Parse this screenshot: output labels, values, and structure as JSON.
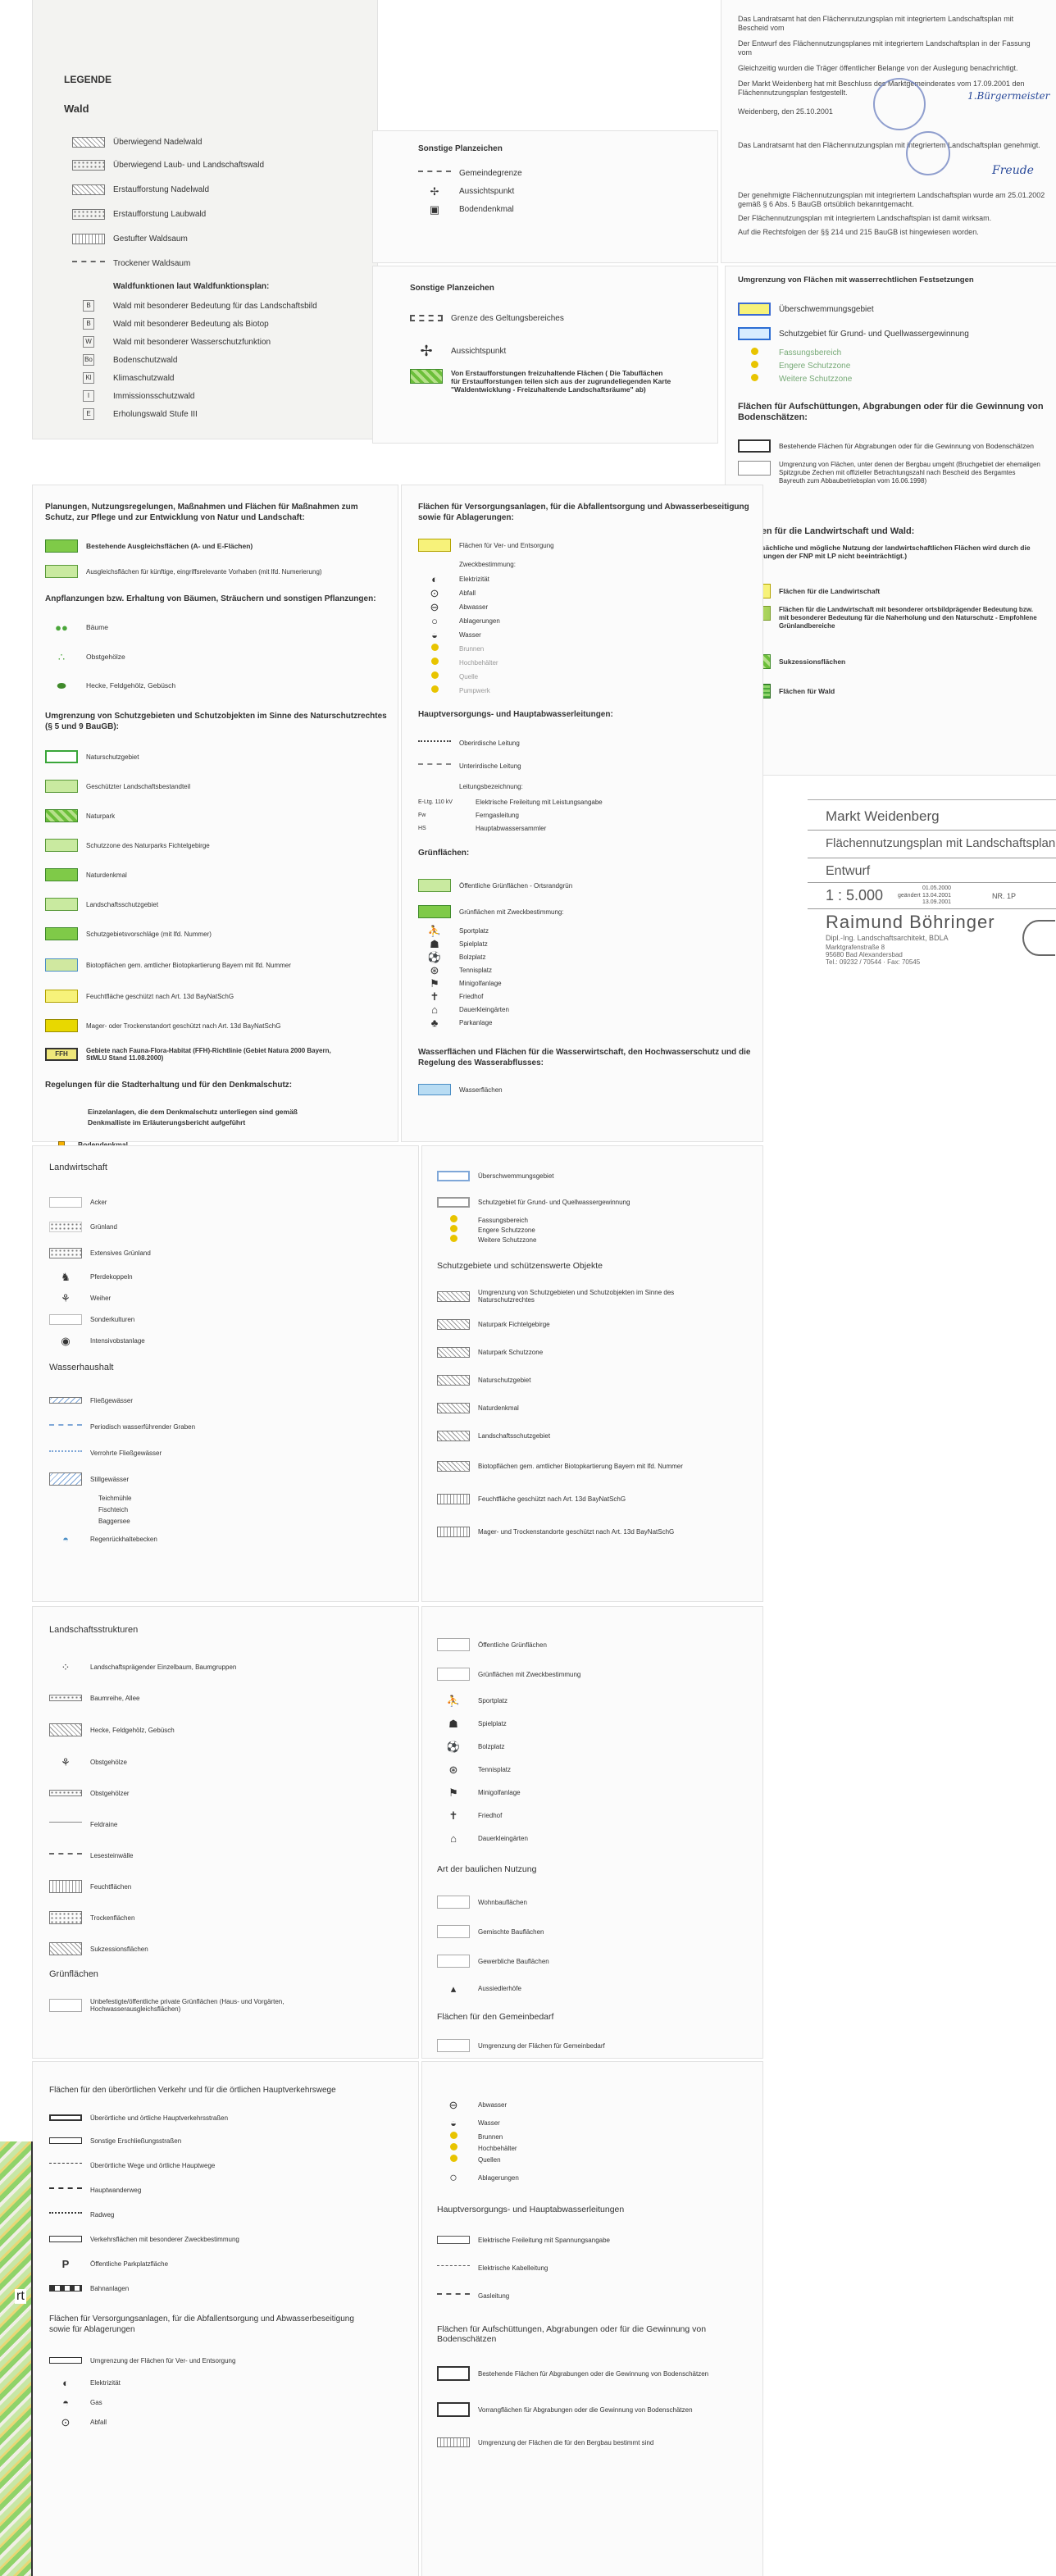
{
  "sheet1": {
    "title": "LEGENDE",
    "wald_heading": "Wald",
    "items": [
      "Überwiegend Nadelwald",
      "Überwiegend Laub- und Landschaftswald",
      "Erstaufforstung Nadelwald",
      "Erstaufforstung Laubwald",
      "Gestufter Waldsaum",
      "Trockener Waldsaum",
      "Waldfunktionen laut Waldfunktionsplan:",
      "Wald mit besonderer Bedeutung für das Landschaftsbild",
      "Wald mit besonderer Bedeutung als Biotop",
      "Wald mit besonderer Wasserschutzfunktion",
      "Bodenschutzwald",
      "Klimaschutzwald",
      "Immissionsschutzwald",
      "Erholungswald Stufe III"
    ],
    "symbols": [
      "L",
      "L",
      "L",
      "L",
      "L",
      "L",
      "",
      "B",
      "B",
      "W",
      "Bo",
      "Kl",
      "I",
      "E"
    ]
  },
  "sheet2": {
    "title": "Sonstige Planzeichen",
    "items": [
      "Gemeindegrenze",
      "Aussichtspunkt",
      "Bodendenkmal"
    ]
  },
  "sheet3": {
    "lines": [
      "Das Landratsamt hat den Flächennutzungsplan mit integriertem Landschaftsplan mit Bescheid vom",
      "Der Entwurf des Flächennutzungsplanes mit integriertem Landschaftsplan in der Fassung vom",
      "Gleichzeitig wurden die Träger öffentlicher Belange von der Auslegung benachrichtigt.",
      "Der Markt Weidenberg hat mit Beschluss des Marktgemeinderates vom 17.09.2001 den Flächennutzungsplan festgestellt.",
      "Weidenberg, den 25.10.2001",
      "Das Landratsamt hat den Flächennutzungsplan mit integriertem Landschaftsplan genehmigt.",
      "Der genehmigte Flächennutzungsplan mit integriertem Landschaftsplan wurde am 25.01.2002 gemäß § 6 Abs. 5 BauGB ortsüblich bekanntgemacht.",
      "Der Flächennutzungsplan mit integriertem Landschaftsplan ist damit wirksam.",
      "Auf die Rechtsfolgen der §§ 214 und 215 BauGB ist hingewiesen worden."
    ],
    "signatures": [
      "1.Bürgermeister",
      "Freude"
    ]
  },
  "sheet4": {
    "title": "Sonstige Planzeichen",
    "items": [
      "Grenze des Geltungsbereiches",
      "Aussichtspunkt",
      "Von Erstaufforstungen freizuhaltende Flächen ( Die Tabuflächen für Erstaufforstungen teilen sich aus der zugrundeliegenden Karte \"Waldentwicklung - Freizuhaltende Landschaftsräume\" ab)"
    ]
  },
  "sheet5": {
    "h1": "Umgrenzung von Flächen mit wasserrechtlichen Festsetzungen",
    "i1": [
      "Überschwemmungsgebiet",
      "Schutzgebiet für Grund- und Quellwassergewinnung",
      "Fassungsbereich",
      "Engere Schutzzone",
      "Weitere Schutzzone"
    ],
    "h2": "Flächen für Aufschüttungen, Abgrabungen oder für die Gewinnung von Bodenschätzen:",
    "i2": [
      "Bestehende Flächen für Abgrabungen oder für die Gewinnung von Bodenschätzen",
      "Umgrenzung von Flächen, unter denen der Bergbau umgeht (Bruchgebiet der ehemaligen Spitzgrube Zechen mit offizieller Betrachtungszahl nach Bescheid des Bergamtes Bayreuth zum Abbaubetriebsplan vom 16.06.1998)"
    ],
    "h3": "Flächen für die Landwirtschaft und Wald:",
    "sub3": "(Die tatsächliche und mögliche Nutzung der landwirtschaftlichen Flächen wird durch die Darstellungen der FNP mit LP nicht beeinträchtigt.)",
    "i3": [
      "Flächen für die Landwirtschaft",
      "Flächen für die Landwirtschaft mit besonderer ortsbildprägender Bedeutung bzw. mit besonderer Bedeutung für die Naherholung und den Naturschutz - Empfohlene Grünlandbereiche",
      "Sukzessionsflächen",
      "Flächen für Wald"
    ]
  },
  "titleblock": {
    "place": "Markt Weidenberg",
    "plan": "Flächennutzungsplan mit Landschaftsplan",
    "stage": "Entwurf",
    "scale": "1 : 5.000",
    "date1": "01.05.2000",
    "date2": "13.04.2001",
    "date3": "13.09.2001",
    "changed": "geändert",
    "ref": "NR. 1P",
    "firm": "Raimund Böhringer",
    "firm_sub": "Dipl.-Ing. Landschaftsarchitekt, BDLA",
    "street": "Marktgrafenstraße 8",
    "city": "95680 Bad Alexandersbad",
    "tel": "Tel.: 09232 / 70544 · Fax: 70545"
  },
  "sheet6": {
    "h1": "Planungen, Nutzungsregelungen, Maßnahmen und Flächen für Maßnahmen zum Schutz, zur Pflege und zur Entwicklung von Natur und Landschaft:",
    "i1": [
      "Bestehende Ausgleichsflächen (A- und E-Flächen)",
      "Ausgleichsflächen für künftige, eingriffsrelevante Vorhaben (mit lfd. Numerierung)"
    ],
    "h2": "Anpflanzungen bzw. Erhaltung von Bäumen, Sträuchern und sonstigen Pflanzungen:",
    "i2": [
      "Bäume",
      "Obstgehölze",
      "Hecke, Feldgehölz, Gebüsch"
    ],
    "h3": "Umgrenzung von Schutzgebieten und Schutzobjekten im Sinne des Naturschutzrechtes (§ 5 und 9 BauGB):",
    "i3": [
      "Naturschutzgebiet",
      "Geschützter Landschaftsbestandteil",
      "Naturpark",
      "Schutzzone des Naturparks Fichtelgebirge",
      "Naturdenkmal",
      "Landschaftsschutzgebiet",
      "Schutzgebietsvorschläge (mit lfd. Nummer)",
      "Biotopflächen gem. amtlicher Biotopkartierung Bayern mit lfd. Nummer",
      "Feuchtfläche geschützt nach Art. 13d BayNatSchG",
      "Mager- oder Trockenstandort geschützt nach Art. 13d BayNatSchG",
      "Gebiete nach Fauna-Flora-Habitat (FFH)-Richtlinie (Gebiet Natura 2000 Bayern, StMLU Stand 11.08.2000)"
    ],
    "h4": "Regelungen für die Stadterhaltung und für den Denkmalschutz:",
    "i4text": "Einzelanlagen, die dem Denkmalschutz unterliegen sind gemäß Denkmalliste im Erläuterungsbericht aufgeführt",
    "i4": "Bodendenkmal"
  },
  "sheet7": {
    "h1": "Flächen für Versorgungsanlagen, für die Abfallentsorgung und Abwasserbeseitigung sowie für Ablagerungen:",
    "i1": [
      "Flächen für Ver- und Entsorgung",
      "Zweckbestimmung:",
      "Elektrizität",
      "Abfall",
      "Abwasser",
      "Ablagerungen",
      "Wasser",
      "Brunnen",
      "Hochbehälter",
      "Quelle",
      "Pumpwerk"
    ],
    "h2": "Hauptversorgungs- und Hauptabwasserleitungen:",
    "i2": [
      "Oberirdische Leitung",
      "Unterirdische Leitung",
      "Leitungsbezeichnung:"
    ],
    "codes": [
      [
        "E-Ltg. 110 kV",
        "Elektrische Freileitung mit Leistungsangabe"
      ],
      [
        "Fw",
        "Ferngasleitung"
      ],
      [
        "HS",
        "Hauptabwassersammler"
      ]
    ],
    "h3": "Grünflächen:",
    "i3": [
      "Öffentliche Grünflächen - Ortsrandgrün",
      "Grünflächen mit Zweckbestimmung:",
      "Sportplatz",
      "Spielplatz",
      "Bolzplatz",
      "Tennisplatz",
      "Minigolfanlage",
      "Friedhof",
      "Dauerkleingärten",
      "Parkanlage"
    ],
    "h4": "Wasserflächen und Flächen für die Wasserwirtschaft, den Hochwasserschutz und die Regelung des Wasserabflusses:",
    "i4": [
      "Wasserflächen"
    ]
  },
  "sheet8": {
    "h1": "Landwirtschaft",
    "i1": [
      "Acker",
      "Grünland",
      "Extensives Grünland",
      "Pferdekoppeln",
      "Weiher",
      "Sonderkulturen",
      "Intensivobstanlage"
    ],
    "h2": "Wasserhaushalt",
    "i2": [
      "Fließgewässer",
      "Periodisch wasserführender Graben",
      "Verrohrte Fließgewässer",
      "Stillgewässer",
      "Teichmühle",
      "Fischteich",
      "Baggersee",
      "Regenrückhaltebecken"
    ]
  },
  "sheet9": {
    "i1": [
      "Überschwemmungsgebiet",
      "Schutzgebiet für Grund- und Quellwassergewinnung",
      "Fassungsbereich",
      "Engere Schutzzone",
      "Weitere Schutzzone"
    ],
    "h2": "Schutzgebiete und schützenswerte Objekte",
    "i2": [
      "Umgrenzung von Schutzgebieten und Schutzobjekten im Sinne des Naturschutzrechtes",
      "Naturpark Fichtelgebirge",
      "Naturpark Schutzzone",
      "Naturschutzgebiet",
      "Naturdenkmal",
      "Landschaftsschutzgebiet",
      "Biotopflächen gem. amtlicher Biotopkartierung Bayern mit lfd. Nummer",
      "Feuchtfläche geschützt nach Art. 13d BayNatSchG",
      "Mager- und Trockenstandorte geschützt nach Art. 13d BayNatSchG"
    ]
  },
  "sheet10": {
    "h1": "Landschaftsstrukturen",
    "i1": [
      "Landschaftsprägender Einzelbaum, Baumgruppen",
      "Baumreihe, Allee",
      "Hecke, Feldgehölz, Gebüsch",
      "Obstgehölze",
      "Obstgehölzer",
      "Feldraine",
      "Lesesteinwälle",
      "Feuchtflächen",
      "Trockenflächen",
      "Sukzessionsflächen"
    ],
    "h2": "Grünflächen",
    "i2": [
      "Unbefestigte/öffentliche private Grünflächen (Haus- und Vorgärten, Hochwasserausgleichsflächen)"
    ]
  },
  "sheet11": {
    "i1": [
      "Öffentliche Grünflächen",
      "Grünflächen mit Zweckbestimmung",
      "Sportplatz",
      "Spielplatz",
      "Bolzplatz",
      "Tennisplatz",
      "Minigolfanlage",
      "Friedhof",
      "Dauerkleingärten"
    ],
    "h2": "Art der baulichen Nutzung",
    "i2": [
      "Wohnbauflächen",
      "Gemischte Bauflächen",
      "Gewerbliche Bauflächen",
      "Aussiedlerhöfe"
    ],
    "h3": "Flächen für den Gemeinbedarf",
    "i3": [
      "Umgrenzung der Flächen für Gemeinbedarf"
    ]
  },
  "sheet12": {
    "h1": "Flächen für den überörtlichen Verkehr und für die örtlichen Hauptverkehrswege",
    "i1": [
      "Überörtliche und örtliche Hauptverkehrsstraßen",
      "Sonstige Erschließungsstraßen",
      "Überörtliche Wege und örtliche Hauptwege",
      "Hauptwanderweg",
      "Radweg",
      "Verkehrsflächen mit besonderer Zweckbestimmung",
      "Öffentliche Parkplatzfläche",
      "Bahnanlagen"
    ],
    "h2": "Flächen für Versorgungsanlagen, für die Abfallentsorgung und Abwasserbeseitigung sowie für Ablagerungen",
    "i2": [
      "Umgrenzung der Flächen für Ver- und Entsorgung",
      "Elektrizität",
      "Gas",
      "Abfall"
    ]
  },
  "sheet13": {
    "i1": [
      "Abwasser",
      "Wasser",
      "Brunnen",
      "Hochbehälter",
      "Quellen",
      "Ablagerungen"
    ],
    "h2": "Hauptversorgungs- und Hauptabwasserleitungen",
    "i2": [
      "Elektrische Freileitung mit Spannungsangabe",
      "Elektrische Kabelleitung",
      "Gasleitung"
    ],
    "h3": "Flächen für Aufschüttungen, Abgrabungen oder für die Gewinnung von Bodenschätzen",
    "i3": [
      "Bestehende Flächen für Abgrabungen oder die Gewinnung von Bodenschätzen",
      "Vorrangflächen für Abgrabungen oder die Gewinnung von Bodenschätzen",
      "Umgrenzung der Flächen die für den Bergbau bestimmt sind"
    ]
  },
  "map_fragment": {
    "label": "rt"
  }
}
